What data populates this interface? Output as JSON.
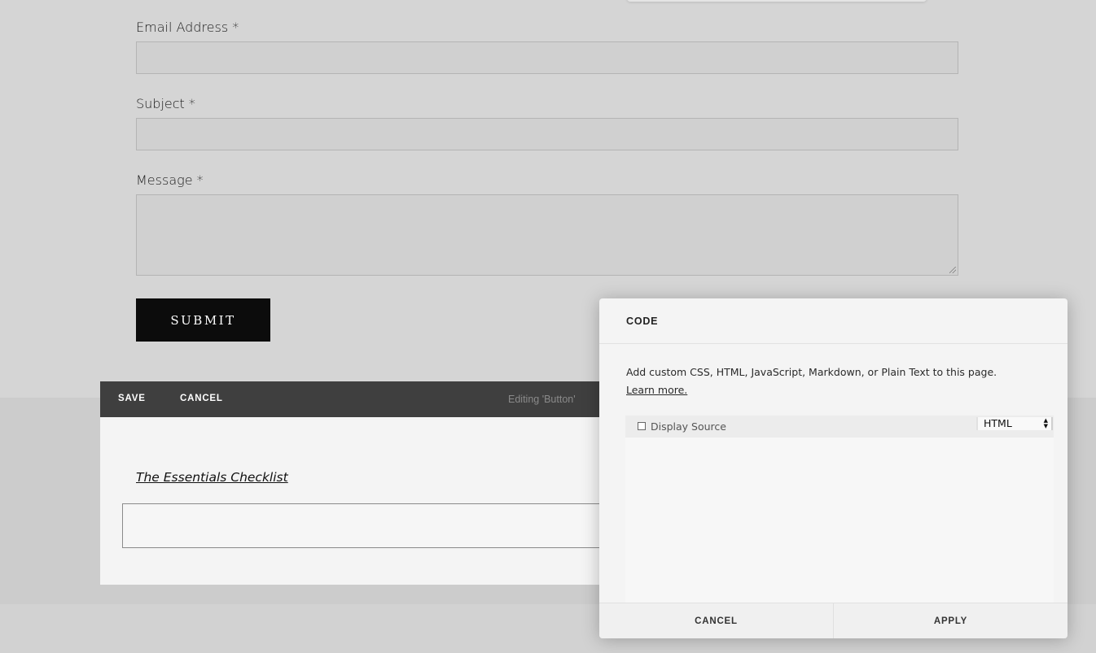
{
  "form": {
    "email_label": "Email Address *",
    "email_value": "",
    "subject_label": "Subject *",
    "subject_value": "",
    "message_label": "Message *",
    "message_value": "",
    "submit_label": "SUBMIT"
  },
  "editor_toolbar": {
    "save_label": "SAVE",
    "cancel_label": "CANCEL",
    "status_text": "Editing 'Button'"
  },
  "editor_content": {
    "link_text": "The Essentials Checklist"
  },
  "code_dialog": {
    "title": "CODE",
    "description": "Add custom CSS, HTML, JavaScript, Markdown, or Plain Text to this page.",
    "learn_more": "Learn more.",
    "display_source_label": "Display Source",
    "display_source_checked": false,
    "language_selected": "HTML",
    "code_value": "",
    "cancel_label": "CANCEL",
    "apply_label": "APPLY"
  },
  "colors": {
    "page_background": "#d5d5d5",
    "toolbar_background": "#3f3f3f",
    "submit_background": "#0c0c0c",
    "dialog_background": "#f4f4f4"
  }
}
